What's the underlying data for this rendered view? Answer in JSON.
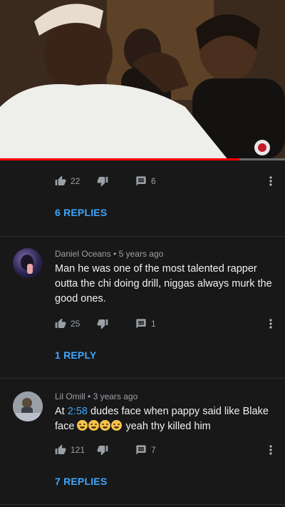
{
  "video": {
    "progress": 0.84
  },
  "icons": {
    "like": "thumbs-up-icon",
    "dislike": "thumbs-down-icon",
    "reply": "reply-icon",
    "more": "more-vertical-icon"
  },
  "colors": {
    "background": "#181818",
    "link": "#3ea6ff",
    "progress": "#ff0000",
    "muted": "#9aa0a6"
  },
  "thread0": {
    "likes": "22",
    "reply_count": "6",
    "replies_link": "6 REPLIES"
  },
  "comments": [
    {
      "author": "Daniel Oceans",
      "dot": "•",
      "time": "5 years ago",
      "text": "Man he was one of the most talented rapper outta the chi doing drill, niggas always murk the good ones.",
      "likes": "25",
      "reply_count": "1",
      "replies_link": "1 REPLY"
    },
    {
      "author": "Lil Omill",
      "dot": "•",
      "time": "3 years ago",
      "text_pre": "At ",
      "timestamp": "2:58",
      "text_mid": " dudes face when pappy said like Blake face ",
      "emoji_count": 4,
      "text_post": " yeah thy killed him",
      "likes": "121",
      "reply_count": "7",
      "replies_link": "7 REPLIES"
    }
  ]
}
